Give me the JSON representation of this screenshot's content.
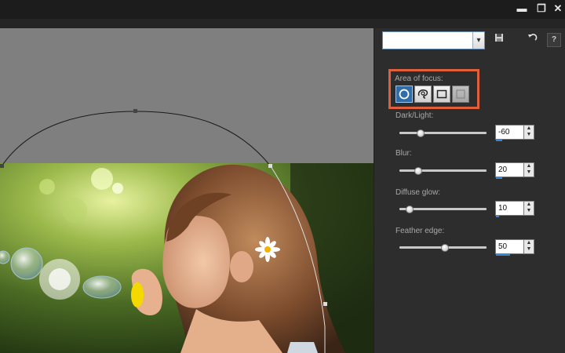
{
  "window": {
    "controls": [
      {
        "name": "minimize-button",
        "glyph": "▬"
      },
      {
        "name": "restore-button",
        "glyph": "❐"
      },
      {
        "name": "close-button",
        "glyph": "✕"
      }
    ]
  },
  "panel": {
    "preset": {
      "value": "",
      "arrow": "▾"
    },
    "help_label": "?",
    "area_of_focus": {
      "label": "Area of focus:",
      "shapes": [
        "circle-icon",
        "freehand-icon",
        "rectangle-icon",
        "remove-icon"
      ],
      "selected_index": 0
    },
    "sliders": [
      {
        "label": "Dark/Light:",
        "value": "-60",
        "fraction": 0.24
      },
      {
        "label": "Blur:",
        "value": "20",
        "fraction": 0.22
      },
      {
        "label": "Diffuse glow:",
        "value": "10",
        "fraction": 0.12
      },
      {
        "label": "Feather edge:",
        "value": "50",
        "fraction": 0.52
      }
    ]
  },
  "colors": {
    "accent_blue": "#3a86d0",
    "highlight_orange": "#e05f3c",
    "canvas_gray": "#7f7f7f"
  }
}
